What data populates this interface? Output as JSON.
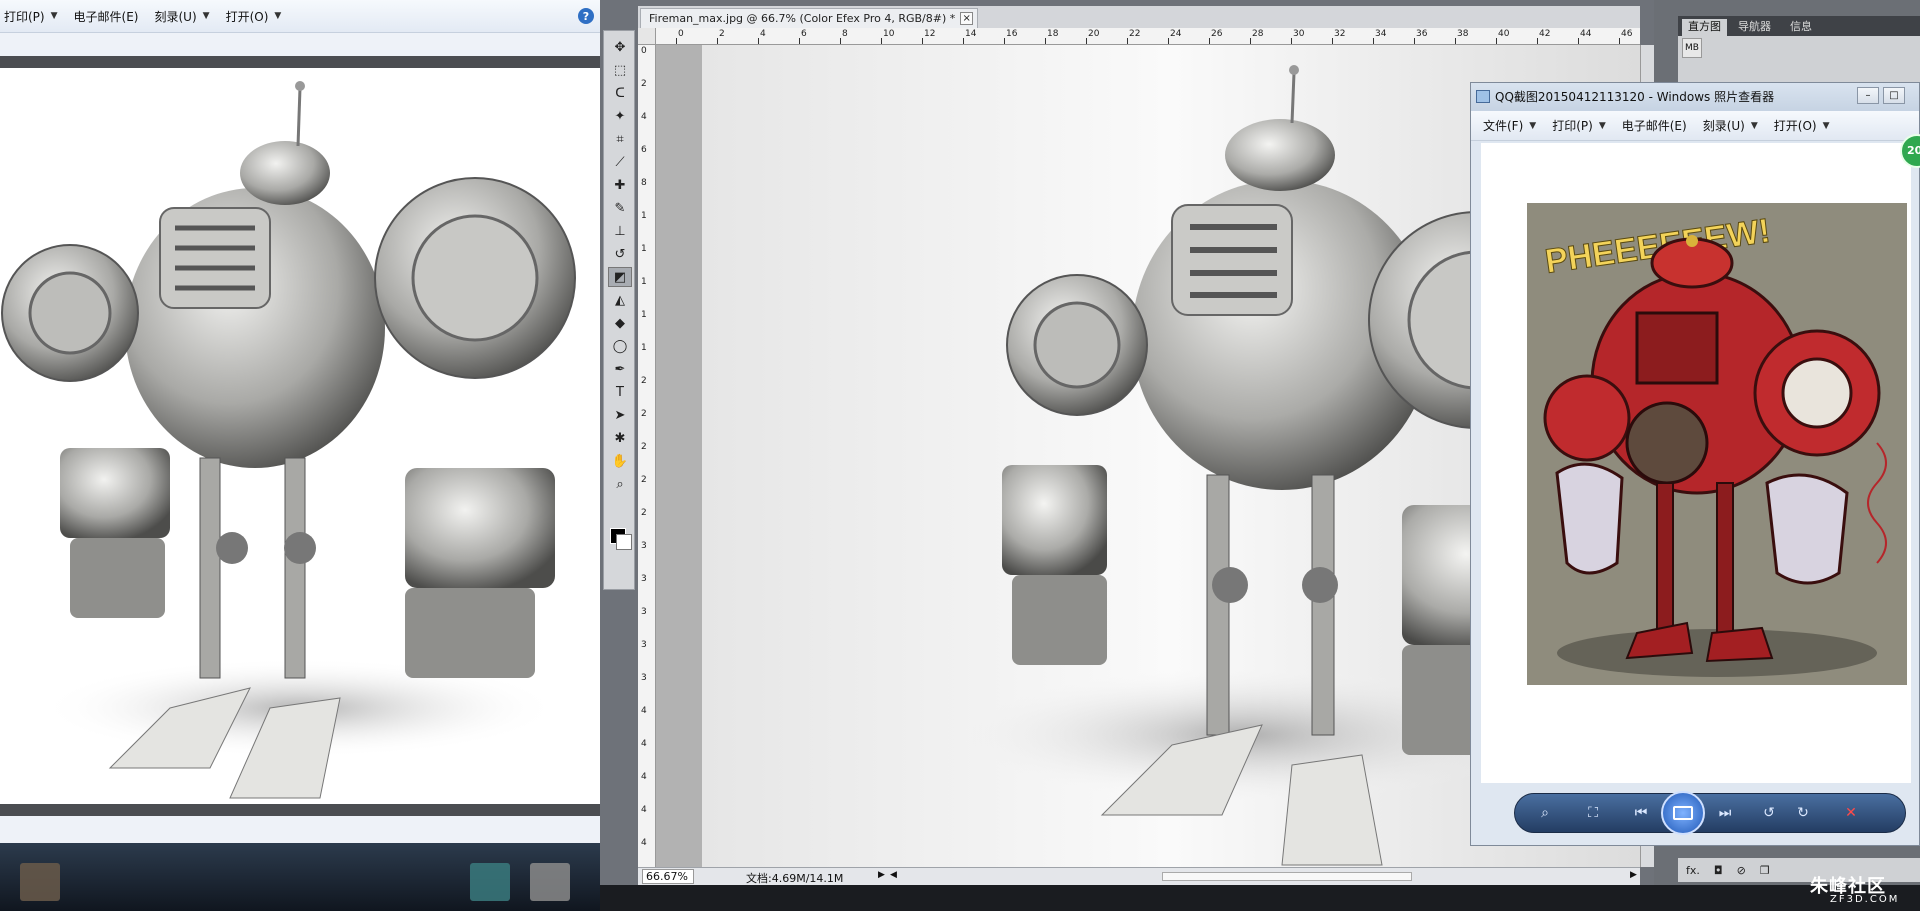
{
  "left_viewer": {
    "menu": [
      {
        "label": "打印(P)"
      },
      {
        "label": "电子邮件(E)"
      },
      {
        "label": "刻录(U)"
      },
      {
        "label": "打开(O)"
      }
    ],
    "help_label": "?"
  },
  "photoshop": {
    "document_tab": "Fireman_max.jpg @ 66.7% (Color Efex Pro 4, RGB/8#) *",
    "close_label": "×",
    "ruler_h_ticks": [
      "0",
      "2",
      "4",
      "6",
      "8",
      "10",
      "12",
      "14",
      "16",
      "18",
      "20",
      "22",
      "24",
      "26",
      "28",
      "30",
      "32",
      "34",
      "36",
      "38",
      "40",
      "42",
      "44",
      "46"
    ],
    "ruler_v_ticks": [
      "0",
      "2",
      "4",
      "6",
      "8",
      "1",
      "1",
      "1",
      "1",
      "1",
      "2",
      "2",
      "2",
      "2",
      "2",
      "3",
      "3",
      "3",
      "3",
      "3",
      "4",
      "4",
      "4",
      "4",
      "4"
    ],
    "zoom": "66.67%",
    "doc_info": "文档:4.69M/14.1M",
    "panel_tabs": [
      "直方图",
      "导航器",
      "信息"
    ],
    "panel_icon": "MB",
    "panel_footer": [
      "fx.",
      "◘",
      "⊘",
      "❐"
    ],
    "tools": [
      {
        "icon": "move-tool-icon",
        "glyph": "✥"
      },
      {
        "icon": "marquee-tool-icon",
        "glyph": "⬚"
      },
      {
        "icon": "lasso-tool-icon",
        "glyph": "ᑕ"
      },
      {
        "icon": "quick-select-tool-icon",
        "glyph": "✦"
      },
      {
        "icon": "crop-tool-icon",
        "glyph": "⌗"
      },
      {
        "icon": "eyedropper-tool-icon",
        "glyph": "⟋"
      },
      {
        "icon": "healing-brush-tool-icon",
        "glyph": "✚"
      },
      {
        "icon": "brush-tool-icon",
        "glyph": "✎"
      },
      {
        "icon": "stamp-tool-icon",
        "glyph": "⊥"
      },
      {
        "icon": "history-brush-tool-icon",
        "glyph": "↺"
      },
      {
        "icon": "eraser-tool-icon",
        "glyph": "◩"
      },
      {
        "icon": "paint-bucket-tool-icon",
        "glyph": "◭"
      },
      {
        "icon": "blur-tool-icon",
        "glyph": "◆"
      },
      {
        "icon": "dodge-tool-icon",
        "glyph": "◯"
      },
      {
        "icon": "pen-tool-icon",
        "glyph": "✒"
      },
      {
        "icon": "type-tool-icon",
        "glyph": "T"
      },
      {
        "icon": "path-select-tool-icon",
        "glyph": "➤"
      },
      {
        "icon": "shape-tool-icon",
        "glyph": "✱"
      },
      {
        "icon": "hand-tool-icon",
        "glyph": "✋"
      },
      {
        "icon": "zoom-tool-icon",
        "glyph": "⌕"
      }
    ]
  },
  "right_viewer": {
    "title": "QQ截图20150412113120 - Windows 照片查看器",
    "menu": [
      {
        "label": "文件(F)"
      },
      {
        "label": "打印(P)"
      },
      {
        "label": "电子邮件(E)"
      },
      {
        "label": "刻录(U)"
      },
      {
        "label": "打开(O)"
      }
    ],
    "badge": "20",
    "min_label": "–",
    "max_label": "□",
    "comic_text": "PHEEEEEEW!"
  },
  "controls": {
    "zoom": "⌕",
    "fit": "⛶",
    "prev": "⏮",
    "next": "⏭",
    "rotate_ccw": "↺",
    "rotate_cw": "↻",
    "delete": "✕"
  },
  "watermark": {
    "cn": "朱峰社区",
    "en": "ZF3D.COM"
  },
  "colors": {
    "viewer_bg": "#eef2f8",
    "ps_chrome": "#6e7279",
    "robot_red": "#b5262a",
    "control_blue": "#243d63"
  }
}
